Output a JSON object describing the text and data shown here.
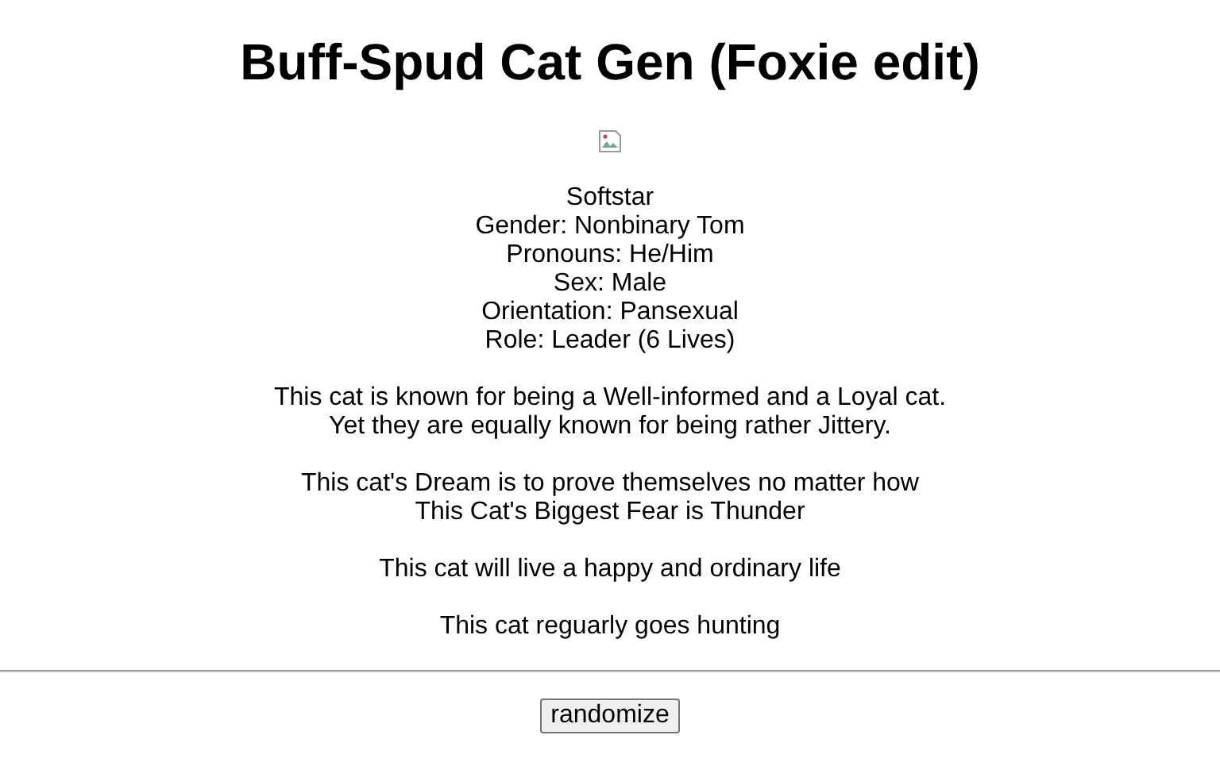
{
  "title": "Buff-Spud Cat Gen (Foxie edit)",
  "image": {
    "kind": "broken"
  },
  "paragraphs": [
    [
      "Softstar",
      "Gender: Nonbinary Tom",
      "Pronouns: He/Him",
      "Sex: Male",
      "Orientation: Pansexual",
      "Role: Leader (6 Lives)"
    ],
    [
      "This cat is known for being a Well-informed and a Loyal cat.",
      "Yet they are equally known for being rather Jittery."
    ],
    [
      "This cat's Dream is to prove themselves no matter how",
      "This Cat's Biggest Fear is Thunder"
    ],
    [
      "This cat will live a happy and ordinary life"
    ],
    [
      "This cat reguarly goes hunting"
    ]
  ],
  "button": "randomize"
}
